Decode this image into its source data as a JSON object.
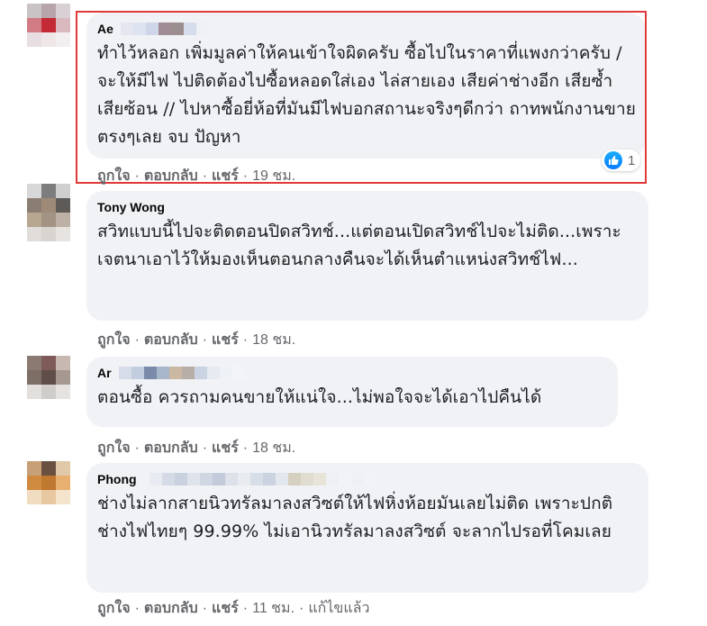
{
  "comments": [
    {
      "author": "Ae",
      "text": "ทำไว้หลอก เพิ่มมูลค่าให้คนเข้าใจผิดครับ ซื้อไปในราคาที่แพงกว่าครับ / จะให้มีไฟ ไปติดต้องไปซื้อหลอดใส่เอง ไล่สายเอง เสียค่าช่างอีก เสียซ้ำเสียซ้อน // ไปหาซื้อยี่ห้อที่มันมีไฟบอกสถานะจริงๆดีกว่า ถาทพนักงานขายตรงๆเลย จบ ปัญหา",
      "like": "ถูกใจ",
      "reply": "ตอบกลับ",
      "share": "แชร์",
      "time": "19 ชม.",
      "reaction_count": "1"
    },
    {
      "author": "Tony Wong",
      "text": "สวิทแบบนี้ไปจะติดตอนปิดสวิทช์...แต่ตอนเปิดสวิทช์ไปจะไม่ติด...เพราะเจตนาเอาไว้ให้มองเห็นตอนกลางคืนจะได้เห็นตำแหน่งสวิทช์ไฟ...",
      "like": "ถูกใจ",
      "reply": "ตอบกลับ",
      "share": "แชร์",
      "time": "18 ชม."
    },
    {
      "author": "Ar",
      "text": "ตอนซื้อ ควรถามคนขายให้แน่ใจ...ไม่พอใจจะได้เอาไปคืนได้",
      "like": "ถูกใจ",
      "reply": "ตอบกลับ",
      "share": "แชร์",
      "time": "18 ชม."
    },
    {
      "author": "Phong",
      "text": "ช่างไม่ลากสายนิวทรัลมาลงสวิซต์ให้ไฟหิ่งห้อยมันเลยไม่ติด เพราะปกติช่างไฟไทยๆ 99.99% ไม่เอานิวทรัลมาลงสวิซต์ จะลากไปรอที่โคมเลย",
      "like": "ถูกใจ",
      "reply": "ตอบกลับ",
      "share": "แชร์",
      "time": "11 ชม.",
      "edited": "แก้ไขแล้ว"
    }
  ],
  "colors": {
    "bubble": "#f0f2f5",
    "meta": "#65676b",
    "highlight": "#e03a3a",
    "like_blue": "#0a7cff"
  }
}
